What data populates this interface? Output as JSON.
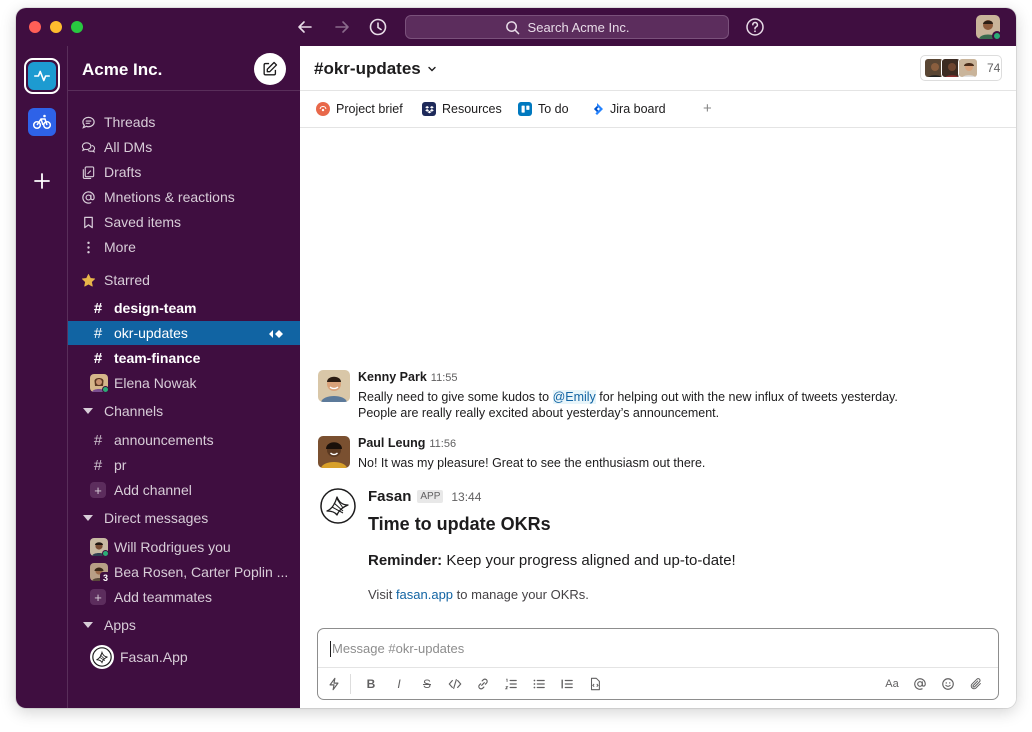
{
  "app": {
    "workspace": "Acme Inc."
  },
  "search": {
    "placeholder": "Search Acme Inc."
  },
  "sidebar": {
    "top_items": [
      {
        "label": "Threads"
      },
      {
        "label": "All DMs"
      },
      {
        "label": "Drafts"
      },
      {
        "label": "Mnetions & reactions"
      },
      {
        "label": "Saved items"
      },
      {
        "label": "More"
      }
    ],
    "starred": {
      "label": "Starred",
      "items": [
        "design-team",
        "okr-updates",
        "team-finance"
      ],
      "dm": "Elena Nowak"
    },
    "channels": {
      "label": "Channels",
      "items": [
        "announcements",
        "pr"
      ],
      "add": "Add channel"
    },
    "dms": {
      "label": "Direct messages",
      "items": [
        "Will Rodrigues you",
        "Bea Rosen, Carter Poplin ..."
      ],
      "group_count": "3",
      "add": "Add teammates"
    },
    "apps": {
      "label": "Apps",
      "items": [
        "Fasan.App"
      ]
    }
  },
  "channel": {
    "name": "#okr-updates",
    "member_count": "74",
    "bookmarks": [
      "Project brief",
      "Resources",
      "To do",
      "Jira board"
    ],
    "add_bookmark": "+"
  },
  "messages": [
    {
      "author": "Kenny Park",
      "time": "11:55",
      "line1_pre": "Really need to give some kudos to ",
      "mention": "@Emily",
      "line1_post": " for helping out with the new influx of tweets yesterday.",
      "line2": "People are really really excited about yesterday’s announcement."
    },
    {
      "author": "Paul Leung",
      "time": "11:56",
      "line1": "No! It was my pleasure! Great to see the enthusiasm out there."
    }
  ],
  "app_message": {
    "author": "Fasan",
    "badge": "APP",
    "time": "13:44",
    "title": "Time to update OKRs",
    "reminder_label": "Reminder:",
    "reminder_text": " Keep your progress aligned and up-to-date!",
    "visit_pre": "Visit ",
    "visit_link": "fasan.app",
    "visit_post": " to manage your OKRs."
  },
  "composer": {
    "placeholder": "Message #okr-updates",
    "format_bold": "B",
    "format_italic": "I",
    "format_strike": "S",
    "text_style": "Aa"
  },
  "colors": {
    "aubergine": "#3f0e40",
    "active": "#1164a3",
    "link": "#1264a3",
    "presence": "#2bac76"
  }
}
